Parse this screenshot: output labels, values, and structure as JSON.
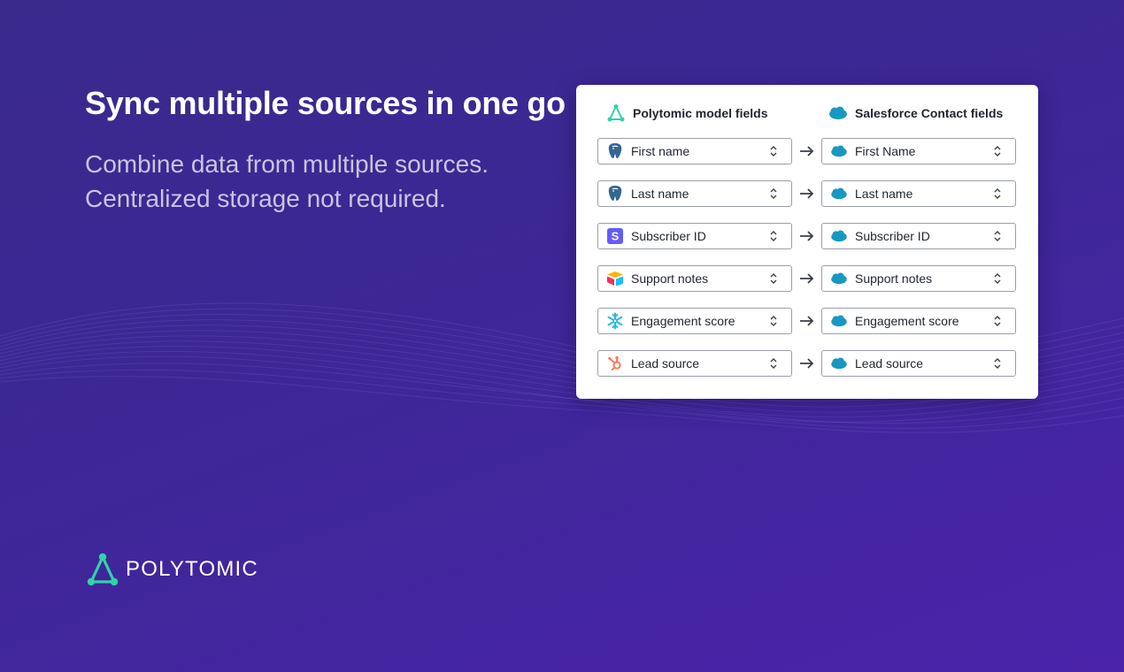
{
  "headline": "Sync multiple sources in one go",
  "subtext": {
    "line1": "Combine data from multiple sources.",
    "line2": "Centralized storage not required."
  },
  "card": {
    "left_header": "Polytomic model fields",
    "right_header": "Salesforce Contact fields",
    "rows": [
      {
        "source_icon": "postgres-icon",
        "source": "First name",
        "target_icon": "salesforce-icon",
        "target": "First Name"
      },
      {
        "source_icon": "postgres-icon",
        "source": "Last name",
        "target_icon": "salesforce-icon",
        "target": "Last name"
      },
      {
        "source_icon": "stripe-icon",
        "source": "Subscriber ID",
        "target_icon": "salesforce-icon",
        "target": "Subscriber ID"
      },
      {
        "source_icon": "airtable-icon",
        "source": "Support notes",
        "target_icon": "salesforce-icon",
        "target": "Support notes"
      },
      {
        "source_icon": "snowflake-icon",
        "source": "Engagement score",
        "target_icon": "salesforce-icon",
        "target": "Engagement score"
      },
      {
        "source_icon": "hubspot-icon",
        "source": "Lead source",
        "target_icon": "salesforce-icon",
        "target": "Lead source"
      }
    ]
  },
  "brand": {
    "wordmark": "POLYTOMIC",
    "accent": "#2fd4a7",
    "salesforce_blue": "#1798c1",
    "stripe_purple": "#635bff",
    "hubspot_orange": "#ff7a59",
    "snowflake_blue": "#29b5e8",
    "postgres_blue": "#336791"
  }
}
